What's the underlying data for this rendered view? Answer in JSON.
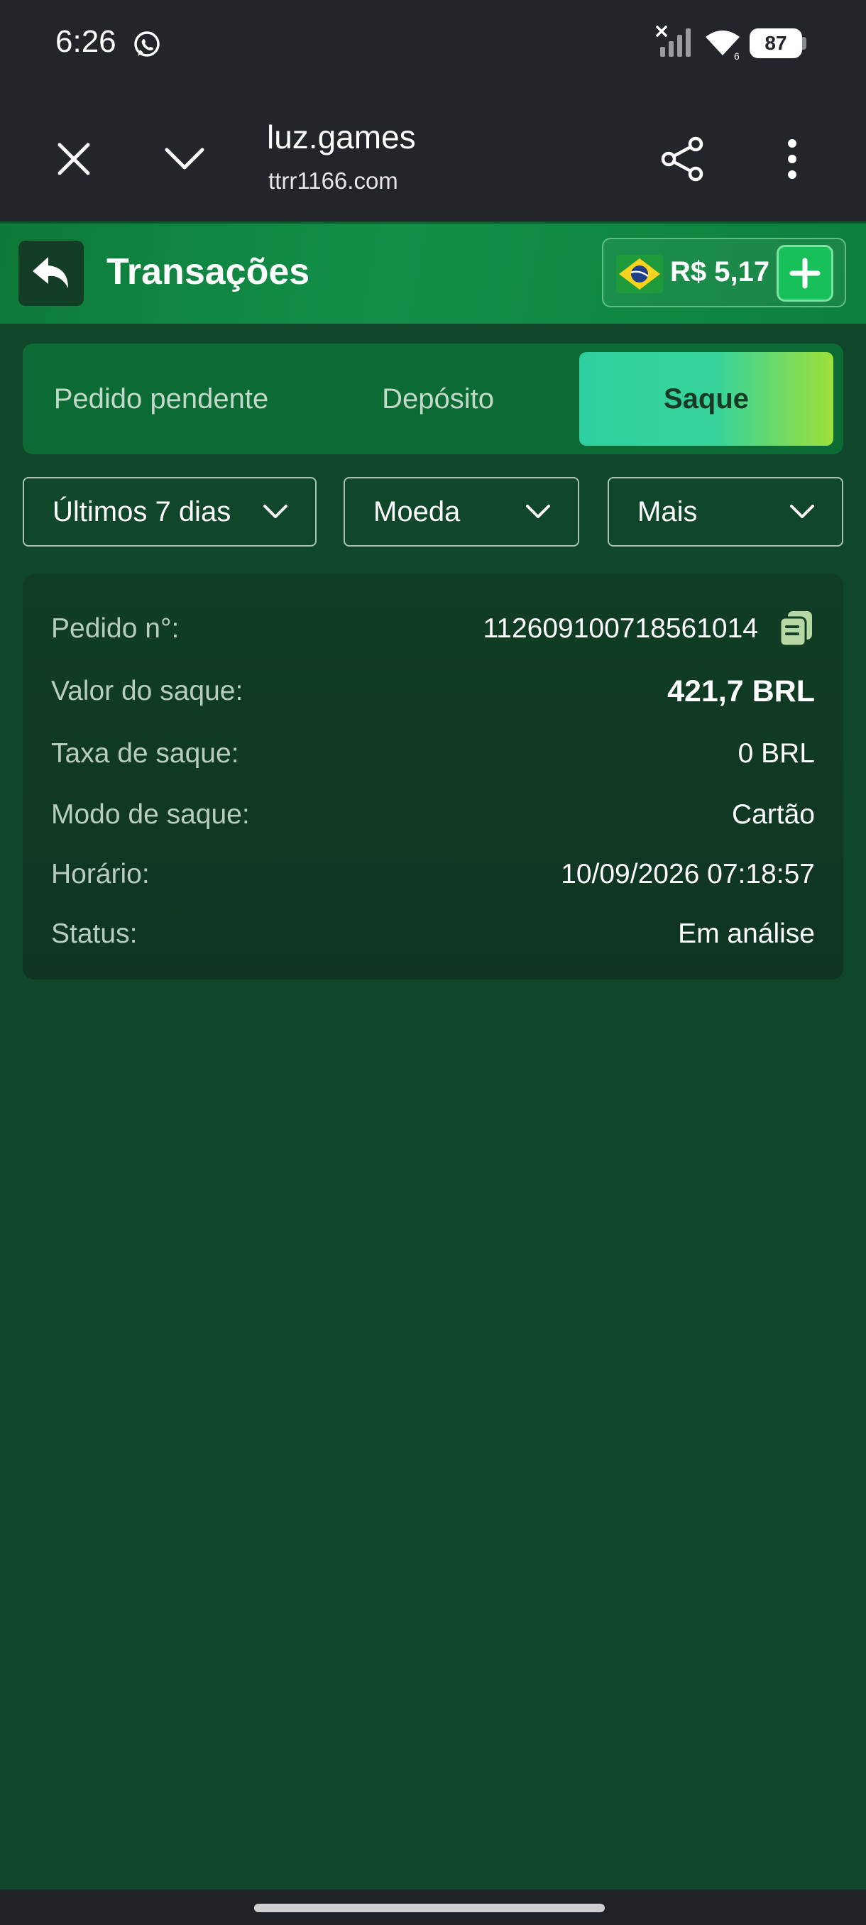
{
  "status_bar": {
    "time": "6:26",
    "battery": "87",
    "icons": [
      "whatsapp-icon",
      "signal-muted-icon",
      "wifi-icon",
      "battery-icon"
    ]
  },
  "browser": {
    "title": "luz.games",
    "url": "ttrr1166.com",
    "icons": [
      "close-icon",
      "chevron-down-icon",
      "share-icon",
      "more-vertical-icon"
    ]
  },
  "header": {
    "title": "Transações",
    "balance": "R$ 5,17",
    "icons": [
      "reply-arrow-icon",
      "brazil-flag-icon",
      "plus-icon"
    ]
  },
  "tabs": [
    {
      "label": "Pedido pendente",
      "active": false
    },
    {
      "label": "Depósito",
      "active": false
    },
    {
      "label": "Saque",
      "active": true
    }
  ],
  "filters": {
    "days": "Últimos 7 dias",
    "currency": "Moeda",
    "more": "Mais"
  },
  "transaction": {
    "rows": [
      {
        "label": "Pedido n°:",
        "value": "112609100718561014"
      },
      {
        "label": "Valor do saque:",
        "value": "421,7 BRL"
      },
      {
        "label": "Taxa de saque:",
        "value": "0 BRL"
      },
      {
        "label": "Modo de saque:",
        "value": "Cartão"
      },
      {
        "label": "Horário:",
        "value": "10/09/2026 07:18:57"
      },
      {
        "label": "Status:",
        "value": "Em análise"
      }
    ]
  },
  "colors": {
    "background": "#10472a",
    "header_green": "#129048",
    "active_tab_start": "#2fcfa0",
    "active_tab_end": "#9ee03a",
    "card": "#113d25",
    "system_bar": "#23252b"
  }
}
